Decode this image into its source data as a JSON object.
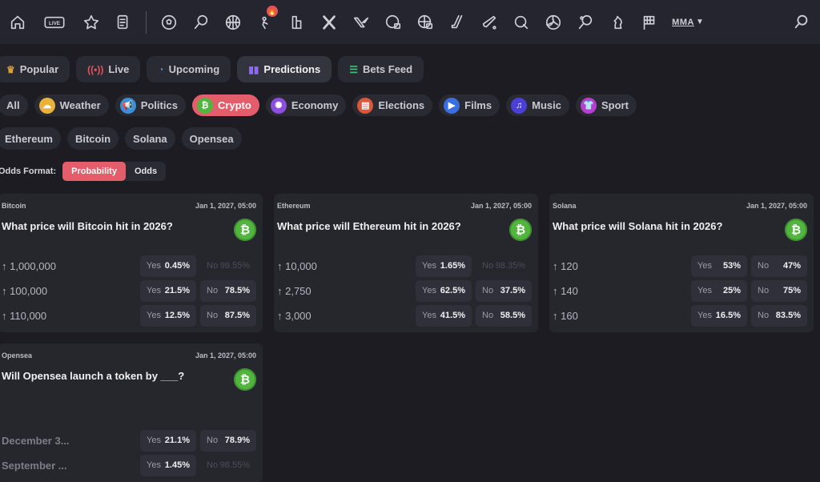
{
  "nav": {
    "icons": [
      "home-icon",
      "live-icon",
      "star-icon",
      "betslip-icon",
      "soccer-icon",
      "tennis-icon",
      "basketball-icon",
      "trending-player-icon",
      "league-icon",
      "esports-x-icon",
      "valorant-icon",
      "soccer-tv-icon",
      "basketball-tv-icon",
      "hockey-icon",
      "cricket-icon",
      "golf-icon",
      "volleyball-icon",
      "table-tennis-icon",
      "chess-icon",
      "racing-flag-icon"
    ],
    "live_badge": "LIVE",
    "mma_label": "MMA",
    "fire_badge": "🔥"
  },
  "tabs": [
    {
      "label": "Popular",
      "icon": "crown-icon",
      "active": false
    },
    {
      "label": "Live",
      "icon": "broadcast-icon",
      "active": false
    },
    {
      "label": "Upcoming",
      "icon": "upcoming-icon",
      "active": false
    },
    {
      "label": "Predictions",
      "icon": "bar-chart-icon",
      "active": true
    },
    {
      "label": "Bets Feed",
      "icon": "list-icon",
      "active": false
    }
  ],
  "categories": [
    {
      "label": "All",
      "active": false
    },
    {
      "label": "Weather",
      "icon": "weather-icon",
      "active": false
    },
    {
      "label": "Politics",
      "icon": "megaphone-icon",
      "active": false
    },
    {
      "label": "Crypto",
      "icon": "bitcoin-icon",
      "active": true
    },
    {
      "label": "Economy",
      "icon": "economy-icon",
      "active": false
    },
    {
      "label": "Elections",
      "icon": "ballot-icon",
      "active": false
    },
    {
      "label": "Films",
      "icon": "camera-icon",
      "active": false
    },
    {
      "label": "Music",
      "icon": "music-icon",
      "active": false
    },
    {
      "label": "Sport",
      "icon": "shirt-icon",
      "active": false
    }
  ],
  "subcategories": [
    "Ethereum",
    "Bitcoin",
    "Solana",
    "Opensea"
  ],
  "odds_format": {
    "label": "Odds Format:",
    "options": [
      "Probability",
      "Odds"
    ],
    "selected": "Probability"
  },
  "markets": [
    {
      "tag": "Bitcoin",
      "date": "Jan 1, 2027, 05:00",
      "question": "What price will Bitcoin hit in 2026?",
      "outcomes": [
        {
          "label": "↑ 1,000,000",
          "yes": "0.45%",
          "no": "99.55%",
          "no_faded": true
        },
        {
          "label": "↑ 100,000",
          "yes": "21.5%",
          "no": "78.5%"
        },
        {
          "label": "↑ 110,000",
          "yes": "12.5%",
          "no": "87.5%"
        }
      ]
    },
    {
      "tag": "Ethereum",
      "date": "Jan 1, 2027, 05:00",
      "question": "What price will Ethereum hit in 2026?",
      "outcomes": [
        {
          "label": "↑ 10,000",
          "yes": "1.65%",
          "no": "98.35%",
          "no_faded": true
        },
        {
          "label": "↑ 2,750",
          "yes": "62.5%",
          "no": "37.5%"
        },
        {
          "label": "↑ 3,000",
          "yes": "41.5%",
          "no": "58.5%"
        }
      ]
    },
    {
      "tag": "Solana",
      "date": "Jan 1, 2027, 05:00",
      "question": "What price will Solana hit in 2026?",
      "outcomes": [
        {
          "label": "↑ 120",
          "yes": "53%",
          "no": "47%"
        },
        {
          "label": "↑ 140",
          "yes": "25%",
          "no": "75%"
        },
        {
          "label": "↑ 160",
          "yes": "16.5%",
          "no": "83.5%"
        }
      ]
    },
    {
      "tag": "Opensea",
      "date": "Jan 1, 2027, 05:00",
      "question": "Will Opensea launch a token by ___?",
      "outcomes": [
        {
          "label": "December 3...",
          "yes": "21.1%",
          "no": "78.9%",
          "dim": true
        },
        {
          "label": "September ...",
          "yes": "1.45%",
          "no": "98.55%",
          "dim": true,
          "no_faded": true
        }
      ]
    }
  ],
  "labels": {
    "yes": "Yes",
    "no": "No"
  },
  "colors": {
    "accent": "#e35d6a",
    "crypto_green": "#52b63e",
    "background": "#1d1c22",
    "card": "#26262d"
  }
}
